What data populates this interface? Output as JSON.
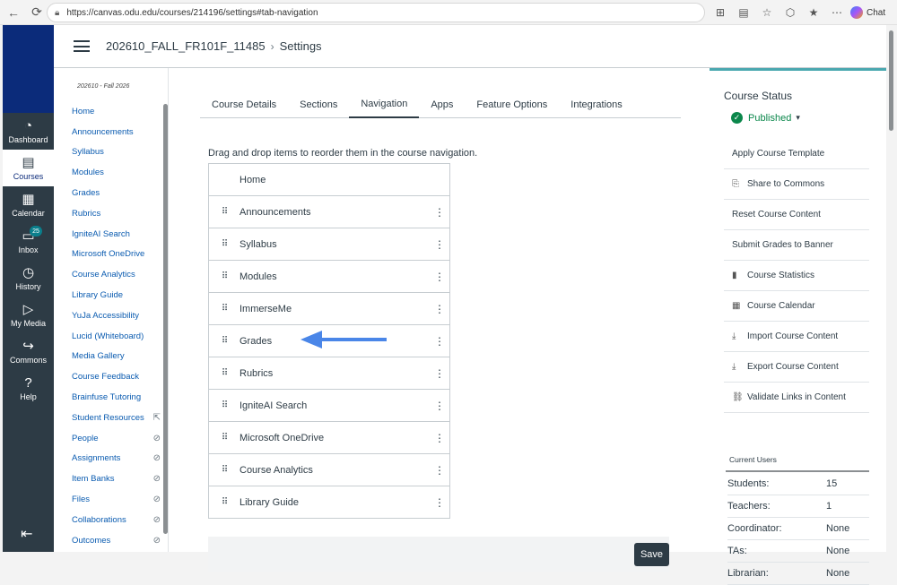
{
  "browser": {
    "url": "https://canvas.odu.edu/courses/214196/settings#tab-navigation",
    "chat_label": "Chat"
  },
  "global_nav": [
    {
      "label": "Dashboard",
      "icon": "dashboard-icon"
    },
    {
      "label": "Courses",
      "icon": "courses-icon"
    },
    {
      "label": "Calendar",
      "icon": "calendar-icon"
    },
    {
      "label": "Inbox",
      "icon": "inbox-icon",
      "badge": "25"
    },
    {
      "label": "History",
      "icon": "history-icon"
    },
    {
      "label": "My Media",
      "icon": "media-icon"
    },
    {
      "label": "Commons",
      "icon": "commons-icon"
    },
    {
      "label": "Help",
      "icon": "help-icon"
    }
  ],
  "header": {
    "course": "202610_FALL_FR101F_11485",
    "separator": "›",
    "page": "Settings"
  },
  "course_nav": {
    "term": "202610 - Fall 2026",
    "items": [
      {
        "label": "Home"
      },
      {
        "label": "Announcements"
      },
      {
        "label": "Syllabus"
      },
      {
        "label": "Modules"
      },
      {
        "label": "Grades"
      },
      {
        "label": "Rubrics"
      },
      {
        "label": "IgniteAI Search"
      },
      {
        "label": "Microsoft OneDrive"
      },
      {
        "label": "Course Analytics"
      },
      {
        "label": "Library Guide"
      },
      {
        "label": "YuJa Accessibility"
      },
      {
        "label": "Lucid (Whiteboard)"
      },
      {
        "label": "Media Gallery"
      },
      {
        "label": "Course Feedback"
      },
      {
        "label": "Brainfuse Tutoring"
      },
      {
        "label": "Student Resources",
        "external": true
      },
      {
        "label": "People",
        "hidden": true
      },
      {
        "label": "Assignments",
        "hidden": true
      },
      {
        "label": "Item Banks",
        "hidden": true
      },
      {
        "label": "Files",
        "hidden": true
      },
      {
        "label": "Collaborations",
        "hidden": true
      },
      {
        "label": "Outcomes",
        "hidden": true
      }
    ]
  },
  "tabs": [
    "Course Details",
    "Sections",
    "Navigation",
    "Apps",
    "Feature Options",
    "Integrations"
  ],
  "active_tab": "Navigation",
  "instruction": "Drag and drop items to reorder them in the course navigation.",
  "nav_list": [
    "Home",
    "Announcements",
    "Syllabus",
    "Modules",
    "ImmerseMe",
    "Grades",
    "Rubrics",
    "IgniteAI Search",
    "Microsoft OneDrive",
    "Course Analytics",
    "Library Guide"
  ],
  "save_label": "Save",
  "sidebar": {
    "title": "Course Status",
    "status": "Published",
    "links": [
      {
        "label": "Apply Course Template",
        "icon": ""
      },
      {
        "label": "Share to Commons",
        "icon": "share-icon"
      },
      {
        "label": "Reset Course Content",
        "icon": ""
      },
      {
        "label": "Submit Grades to Banner",
        "icon": ""
      },
      {
        "label": "Course Statistics",
        "icon": "stats-icon"
      },
      {
        "label": "Course Calendar",
        "icon": "calendar-icon"
      },
      {
        "label": "Import Course Content",
        "icon": "import-icon"
      },
      {
        "label": "Export Course Content",
        "icon": "export-icon"
      },
      {
        "label": "Validate Links in Content",
        "icon": "link-icon"
      }
    ],
    "users_title": "Current Users",
    "users": [
      {
        "role": "Students:",
        "count": "15"
      },
      {
        "role": "Teachers:",
        "count": "1"
      },
      {
        "role": "Coordinator:",
        "count": "None"
      },
      {
        "role": "TAs:",
        "count": "None"
      },
      {
        "role": "Librarian:",
        "count": "None"
      }
    ]
  },
  "colors": {
    "accent": "#2d3b45",
    "link": "#0a5bb0",
    "published": "#0b874b",
    "arrow": "#4a86e8"
  }
}
